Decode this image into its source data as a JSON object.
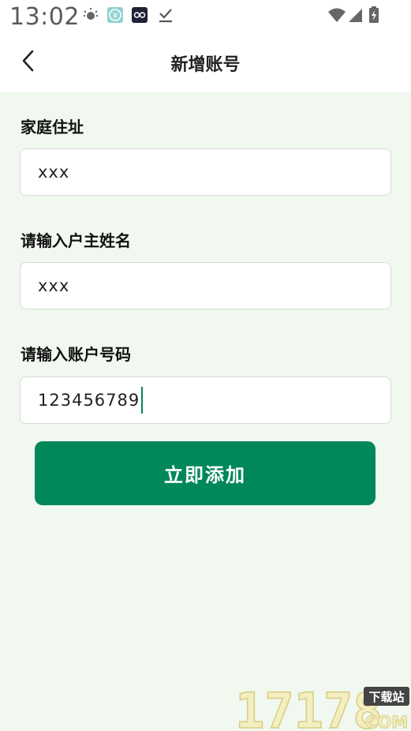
{
  "status_bar": {
    "time": "13:02",
    "left_icons": [
      "sun-notification-icon",
      "yuan-app-icon",
      "glasses-app-icon",
      "download-done-icon"
    ],
    "right_icons": [
      "wifi-icon",
      "signal-icon",
      "battery-charging-icon"
    ]
  },
  "header": {
    "title": "新增账号",
    "back_icon": "chevron-left-icon"
  },
  "form": {
    "address_label": "家庭住址",
    "address_value": "xxx",
    "owner_label": "请输入户主姓名",
    "owner_value": "xxx",
    "account_label": "请输入账户号码",
    "account_value": "123456789"
  },
  "submit_label": "立即添加",
  "colors": {
    "accent": "#00875a",
    "background": "#f1f8ef",
    "header_bg": "#ffffff"
  },
  "watermark": {
    "text": "17178",
    "suffix": "COM",
    "tag": "下载站"
  }
}
